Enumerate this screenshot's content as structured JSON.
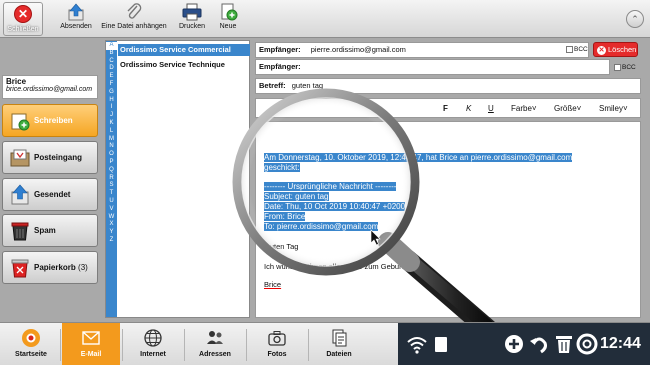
{
  "toolbar": {
    "close_label": "Schließen",
    "send_label": "Absenden",
    "attach_label": "Eine Datei anhängen",
    "print_label": "Drucken",
    "new_label": "Neue"
  },
  "account": {
    "name": "Brice",
    "email": "brice.ordissimo@gmail.com"
  },
  "folders": [
    {
      "label": "Schreiben"
    },
    {
      "label": "Posteingang"
    },
    {
      "label": "Gesendet"
    },
    {
      "label": "Spam"
    },
    {
      "label": "Papierkorb",
      "count": "(3)"
    }
  ],
  "alphabet": [
    "A",
    "B",
    "C",
    "D",
    "E",
    "F",
    "G",
    "H",
    "I",
    "J",
    "K",
    "L",
    "M",
    "N",
    "O",
    "P",
    "Q",
    "R",
    "S",
    "T",
    "U",
    "V",
    "W",
    "X",
    "Y",
    "Z"
  ],
  "contacts": [
    {
      "name": "Ordissimo Service Commercial"
    },
    {
      "name": "Ordissimo Service Technique"
    }
  ],
  "compose": {
    "to_label": "Empfänger:",
    "to_value": "pierre.ordissimo@gmail.com",
    "cc_label": "Empfänger:",
    "cc_value": "",
    "bcc_label": "BCC",
    "delete_label": "Löschen",
    "subject_label": "Betreff:",
    "subject_value": "guten tag"
  },
  "format": {
    "bold": "F",
    "italic": "K",
    "underline": "U",
    "color": "Farbe",
    "size": "Größe",
    "smiley": "Smiley"
  },
  "body": {
    "quote_line1": "Am Donnerstag, 10. Oktober 2019, 12:40:47, hat Brice an pierre.ordissimo@gmail.com",
    "quote_line2": "geschickt:",
    "orig_header": "-------- Ursprüngliche Nachricht --------",
    "orig_subject": "Subject: guten tag",
    "orig_date": "Date: Thu, 10 Oct 2019 10:40:47 +0200",
    "orig_from": "From: Brice",
    "orig_to": "To: pierre.ordissimo@gmail.com",
    "greeting": "Guten Tag",
    "line": "Ich wünsche Ihnen alles Gute zum Geburtstag",
    "signature": "Brice"
  },
  "bottombar": {
    "items": [
      "Startseite",
      "E-Mail",
      "Internet",
      "Adressen",
      "Fotos",
      "Dateien"
    ],
    "clock": "12:44"
  },
  "colors": {
    "accent": "#f39a1d",
    "selection": "#3a86cc",
    "delete": "#e52b2b",
    "tray": "#222d3a"
  }
}
